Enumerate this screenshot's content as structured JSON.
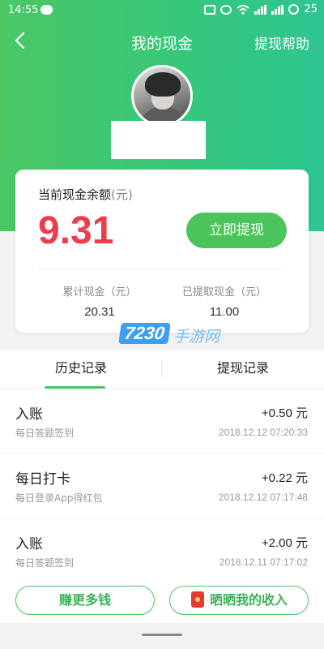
{
  "status_bar": {
    "time": "14:55",
    "battery": "25",
    "icons": [
      "chat-icon",
      "vibrate-icon",
      "alarm-icon",
      "wifi-icon",
      "signal-icon",
      "battery-icon"
    ]
  },
  "nav": {
    "title": "我的现金",
    "help": "提现帮助"
  },
  "balance": {
    "label": "当前现金余额",
    "unit": "(元)",
    "value": "9.31",
    "withdraw_button": "立即提现",
    "total_label": "累计现金（元）",
    "total_value": "20.31",
    "withdrawn_label": "已提取现金（元）",
    "withdrawn_value": "11.00"
  },
  "watermark": {
    "number": "7230",
    "text": "手游网"
  },
  "tabs": [
    {
      "label": "历史记录",
      "active": true
    },
    {
      "label": "提现记录",
      "active": false
    }
  ],
  "records": [
    {
      "title": "入账",
      "subtitle": "每日答题签到",
      "amount": "+0.50 元",
      "time": "2018.12.12 07:20:33"
    },
    {
      "title": "每日打卡",
      "subtitle": "每日登录App得红包",
      "amount": "+0.22 元",
      "time": "2018.12.12 07:17:48"
    },
    {
      "title": "入账",
      "subtitle": "每日答题签到",
      "amount": "+2.00 元",
      "time": "2018.12.11 07:17:02"
    }
  ],
  "bottom": {
    "earn_more": "赚更多钱",
    "show_income": "晒晒我的收入"
  },
  "colors": {
    "brand_green": "#4bc55b",
    "balance_red": "#ef3b4e"
  }
}
